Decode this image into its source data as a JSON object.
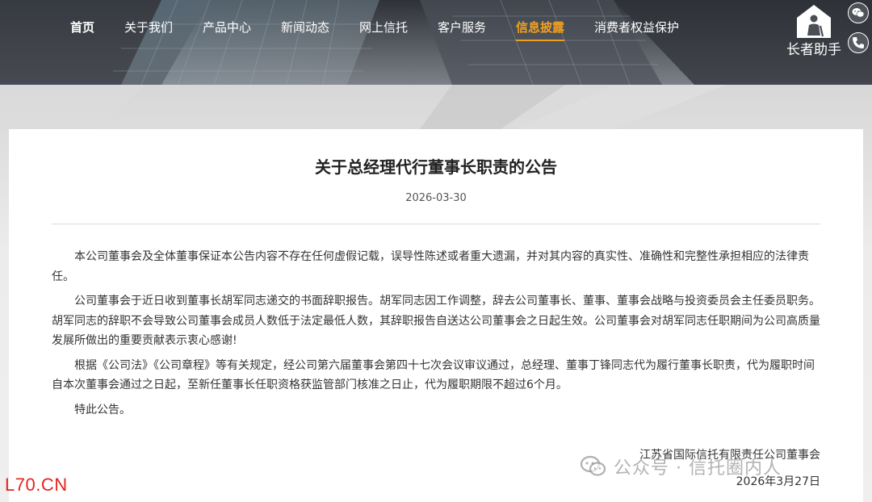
{
  "nav": {
    "items": [
      {
        "label": "首页",
        "state": "home"
      },
      {
        "label": "关于我们",
        "state": "normal"
      },
      {
        "label": "产品中心",
        "state": "normal"
      },
      {
        "label": "新闻动态",
        "state": "normal"
      },
      {
        "label": "网上信托",
        "state": "normal"
      },
      {
        "label": "客户服务",
        "state": "normal"
      },
      {
        "label": "信息披露",
        "state": "active"
      },
      {
        "label": "消费者权益保护",
        "state": "normal"
      }
    ]
  },
  "elder_helper": {
    "label": "长者助手",
    "icon": "house-person-icon"
  },
  "side_icons": [
    "wechat-icon",
    "phone-icon"
  ],
  "colors": {
    "accent": "#f0a020",
    "watermark_red": "#e0261f"
  },
  "article": {
    "title": "关于总经理代行董事长职责的公告",
    "date": "2026-03-30",
    "paragraphs": [
      "本公司董事会及全体董事保证本公告内容不存在任何虚假记载，误导性陈述或者重大遗漏，并对其内容的真实性、准确性和完整性承担相应的法律责任。",
      "公司董事会于近日收到董事长胡军同志递交的书面辞职报告。胡军同志因工作调整，辞去公司董事长、董事、董事会战略与投资委员会主任委员职务。胡军同志的辞职不会导致公司董事会成员人数低于法定最低人数，其辞职报告自送达公司董事会之日起生效。公司董事会对胡军同志任职期间为公司高质量发展所做出的重要贡献表示衷心感谢!",
      "根据《公司法》《公司章程》等有关规定，经公司第六届董事会第四十七次会议审议通过，总经理、董事丁锋同志代为履行董事长职责，代为履职时间自本次董事会通过之日起，至新任董事长任职资格获监管部门核准之日止，代为履职期限不超过6个月。",
      "特此公告。"
    ],
    "signature": {
      "org": "江苏省国际信托有限责任公司董事会",
      "date": "2026年3月27日"
    }
  },
  "watermarks": {
    "wechat": "公众号 · 信托圈内人",
    "site": "L70.CN"
  }
}
